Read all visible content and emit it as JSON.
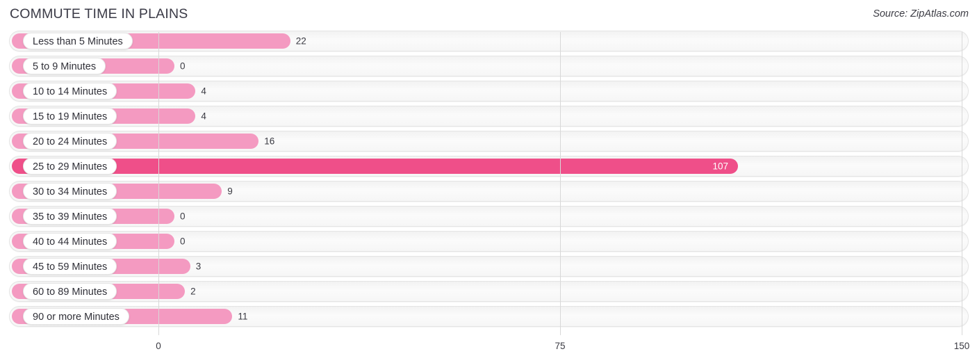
{
  "header": {
    "title": "COMMUTE TIME IN PLAINS",
    "source": "Source: ZipAtlas.com"
  },
  "colors": {
    "bar": "#f49ac1",
    "bar_highlight": "#ef4f89",
    "track": "#f6f6f6",
    "gridline": "#d8d8d8",
    "text": "#3a3a42"
  },
  "chart_data": {
    "type": "bar",
    "orientation": "horizontal",
    "title": "COMMUTE TIME IN PLAINS",
    "xlabel": "",
    "ylabel": "",
    "xlim": [
      0,
      150
    ],
    "xticks": [
      0,
      75,
      150
    ],
    "xtick_labels": [
      "0",
      "75",
      "150"
    ],
    "grid": true,
    "legend": false,
    "highlight_category": "25 to 29 Minutes",
    "categories": [
      "Less than 5 Minutes",
      "5 to 9 Minutes",
      "10 to 14 Minutes",
      "15 to 19 Minutes",
      "20 to 24 Minutes",
      "25 to 29 Minutes",
      "30 to 34 Minutes",
      "35 to 39 Minutes",
      "40 to 44 Minutes",
      "45 to 59 Minutes",
      "60 to 89 Minutes",
      "90 or more Minutes"
    ],
    "values": [
      22,
      0,
      4,
      4,
      16,
      107,
      9,
      0,
      0,
      3,
      2,
      11
    ],
    "value_labels": [
      "22",
      "0",
      "4",
      "4",
      "16",
      "107",
      "9",
      "0",
      "0",
      "3",
      "2",
      "11"
    ]
  }
}
